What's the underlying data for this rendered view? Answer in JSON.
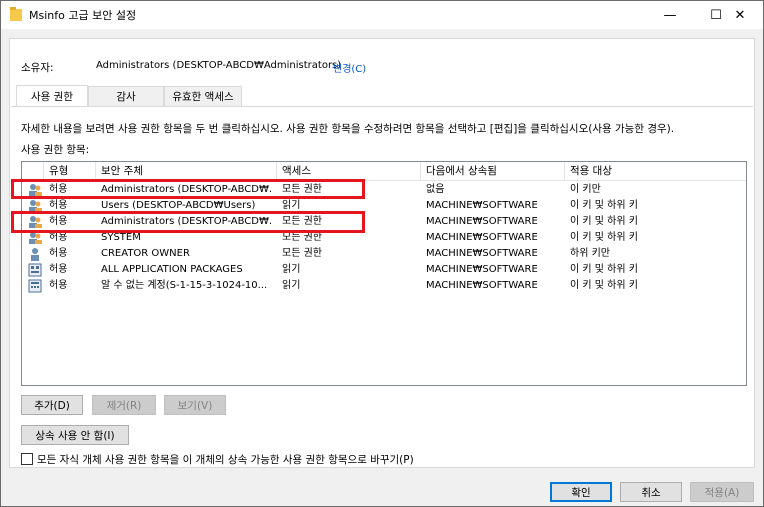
{
  "window": {
    "title": "Msinfo 고급 보안 설정",
    "minimize": "—",
    "maximize": "☐",
    "close": "✕"
  },
  "owner": {
    "label": "소유자:",
    "value": "Administrators (DESKTOP-ABCD₩Administrators)",
    "change_link": "변경(C)"
  },
  "tabs": [
    {
      "label": "사용 권한",
      "active": true
    },
    {
      "label": "감사",
      "active": false
    },
    {
      "label": "유효한 액세스",
      "active": false
    }
  ],
  "panel": {
    "description": "자세한 내용을 보려면 사용 권한 항목을 두 번 클릭하십시오. 사용 권한 항목을 수정하려면 항목을 선택하고 [편집]을 클릭하십시오(사용 가능한 경우).",
    "entries_label": "사용 권한 항목:"
  },
  "columns": [
    "",
    "유형",
    "보안 주체",
    "액세스",
    "다음에서 상속됨",
    "적용 대상"
  ],
  "rows": [
    {
      "icon": "user-group-icon",
      "type": "허용",
      "principal": "Administrators (DESKTOP-ABCD₩...",
      "access": "모든 권한",
      "inherited_from": "없음",
      "applies_to": "이 키만",
      "highlighted": true
    },
    {
      "icon": "user-group-icon",
      "type": "허용",
      "principal": "Users (DESKTOP-ABCD₩Users)",
      "access": "읽기",
      "inherited_from": "MACHINE₩SOFTWARE",
      "applies_to": "이 키 및 하위 키",
      "highlighted": false
    },
    {
      "icon": "user-group-icon",
      "type": "허용",
      "principal": "Administrators (DESKTOP-ABCD₩...",
      "access": "모든 권한",
      "inherited_from": "MACHINE₩SOFTWARE",
      "applies_to": "이 키 및 하위 키",
      "highlighted": true
    },
    {
      "icon": "user-group-icon",
      "type": "허용",
      "principal": "SYSTEM",
      "access": "모든 권한",
      "inherited_from": "MACHINE₩SOFTWARE",
      "applies_to": "이 키 및 하위 키",
      "highlighted": false
    },
    {
      "icon": "user-icon",
      "type": "허용",
      "principal": "CREATOR OWNER",
      "access": "모든 권한",
      "inherited_from": "MACHINE₩SOFTWARE",
      "applies_to": "하위 키만",
      "highlighted": false
    },
    {
      "icon": "app-packages-icon",
      "type": "허용",
      "principal": "ALL APPLICATION PACKAGES",
      "access": "읽기",
      "inherited_from": "MACHINE₩SOFTWARE",
      "applies_to": "이 키 및 하위 키",
      "highlighted": false
    },
    {
      "icon": "unknown-account-icon",
      "type": "허용",
      "principal": "알 수 없는 계정(S-1-15-3-1024-10...",
      "access": "읽기",
      "inherited_from": "MACHINE₩SOFTWARE",
      "applies_to": "이 키 및 하위 키",
      "highlighted": false
    }
  ],
  "buttons": {
    "add": "추가(D)",
    "remove": "제거(R)",
    "view": "보기(V)",
    "disable_inheritance": "상속 사용 안 함(I)",
    "replace_child_checkbox": "모든 자식 개체 사용 권한 항목을 이 개체의 상속 가능한 사용 권한 항목으로 바꾸기(P)",
    "ok": "확인",
    "cancel": "취소",
    "apply": "적용(A)"
  },
  "colors": {
    "highlight": "#e6141e",
    "accent": "#0078d7",
    "link": "#0a58ca"
  }
}
